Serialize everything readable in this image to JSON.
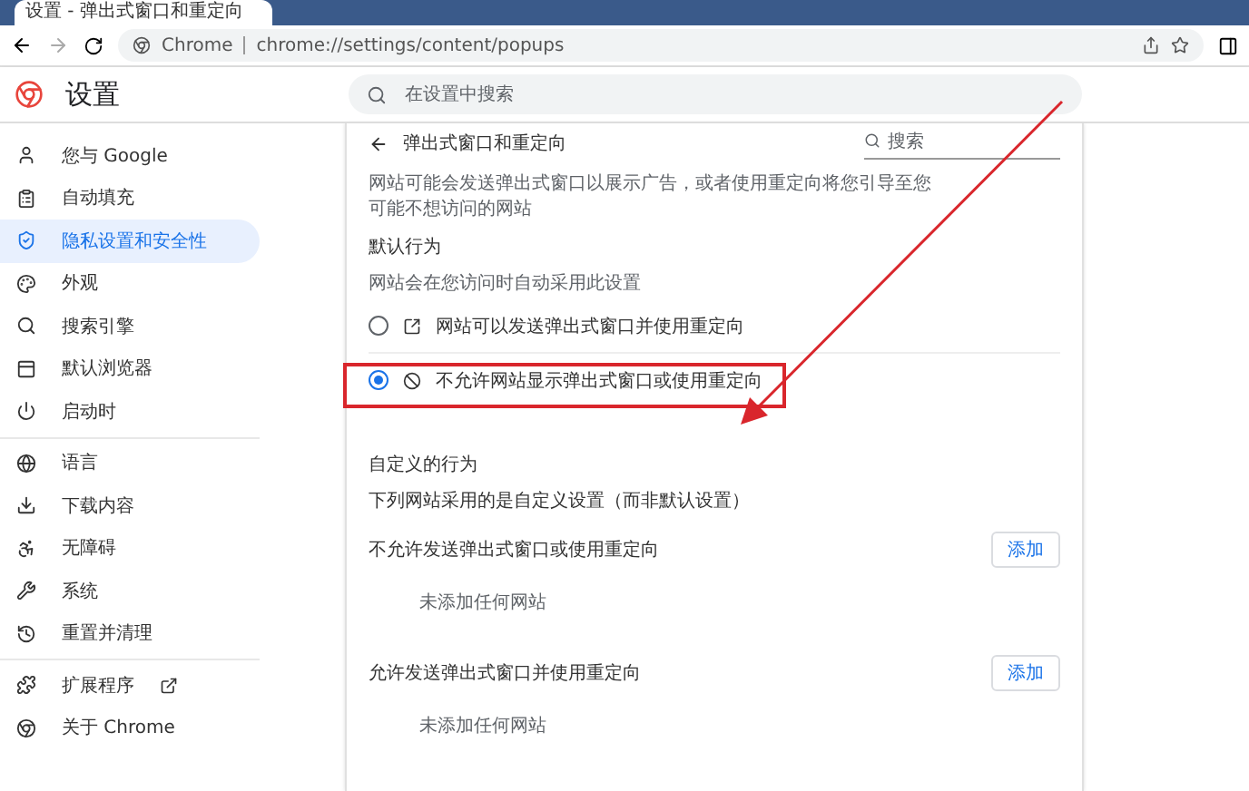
{
  "browser": {
    "tab_title": "设置 - 弹出式窗口和重定向",
    "url_site": "Chrome",
    "url_path": "chrome://settings/content/popups"
  },
  "header": {
    "title": "设置",
    "search": {
      "placeholder": "在设置中搜索"
    }
  },
  "sidebar": {
    "groups": [
      [
        {
          "label": "您与 Google",
          "selected": false,
          "kind": "page"
        },
        {
          "label": "自动填充",
          "selected": false,
          "kind": "page"
        },
        {
          "label": "隐私设置和安全性",
          "selected": true,
          "kind": "page"
        },
        {
          "label": "外观",
          "selected": false,
          "kind": "page"
        },
        {
          "label": "搜索引擎",
          "selected": false,
          "kind": "page"
        },
        {
          "label": "默认浏览器",
          "selected": false,
          "kind": "page"
        },
        {
          "label": "启动时",
          "selected": false,
          "kind": "page"
        }
      ],
      [
        {
          "label": "语言",
          "selected": false,
          "kind": "page"
        },
        {
          "label": "下载内容",
          "selected": false,
          "kind": "page"
        },
        {
          "label": "无障碍",
          "selected": false,
          "kind": "page"
        },
        {
          "label": "系统",
          "selected": false,
          "kind": "page"
        },
        {
          "label": "重置并清理",
          "selected": false,
          "kind": "page"
        }
      ],
      [
        {
          "label": "扩展程序",
          "selected": false,
          "kind": "external"
        },
        {
          "label": "关于 Chrome",
          "selected": false,
          "kind": "page"
        }
      ]
    ]
  },
  "content": {
    "title": "弹出式窗口和重定向",
    "search": {
      "placeholder": "搜索"
    },
    "description": "网站可能会发送弹出式窗口以展示广告，或者使用重定向将您引导至您可能不想访问的网站",
    "default_heading": "默认行为",
    "default_subtitle": "网站会在您访问时自动采用此设置",
    "options": [
      {
        "label": "网站可以发送弹出式窗口并使用重定向",
        "selected": false,
        "kind": "allow"
      },
      {
        "label": "不允许网站显示弹出式窗口或使用重定向",
        "selected": true,
        "kind": "block"
      }
    ],
    "custom_heading": "自定义的行为",
    "custom_subtitle": "下列网站采用的是自定义设置（而非默认设置）",
    "exceptions": [
      {
        "title": "不允许发送弹出式窗口或使用重定向",
        "button": "添加",
        "empty": "未添加任何网站"
      },
      {
        "title": "允许发送弹出式窗口并使用重定向",
        "button": "添加",
        "empty": "未添加任何网站"
      }
    ]
  }
}
